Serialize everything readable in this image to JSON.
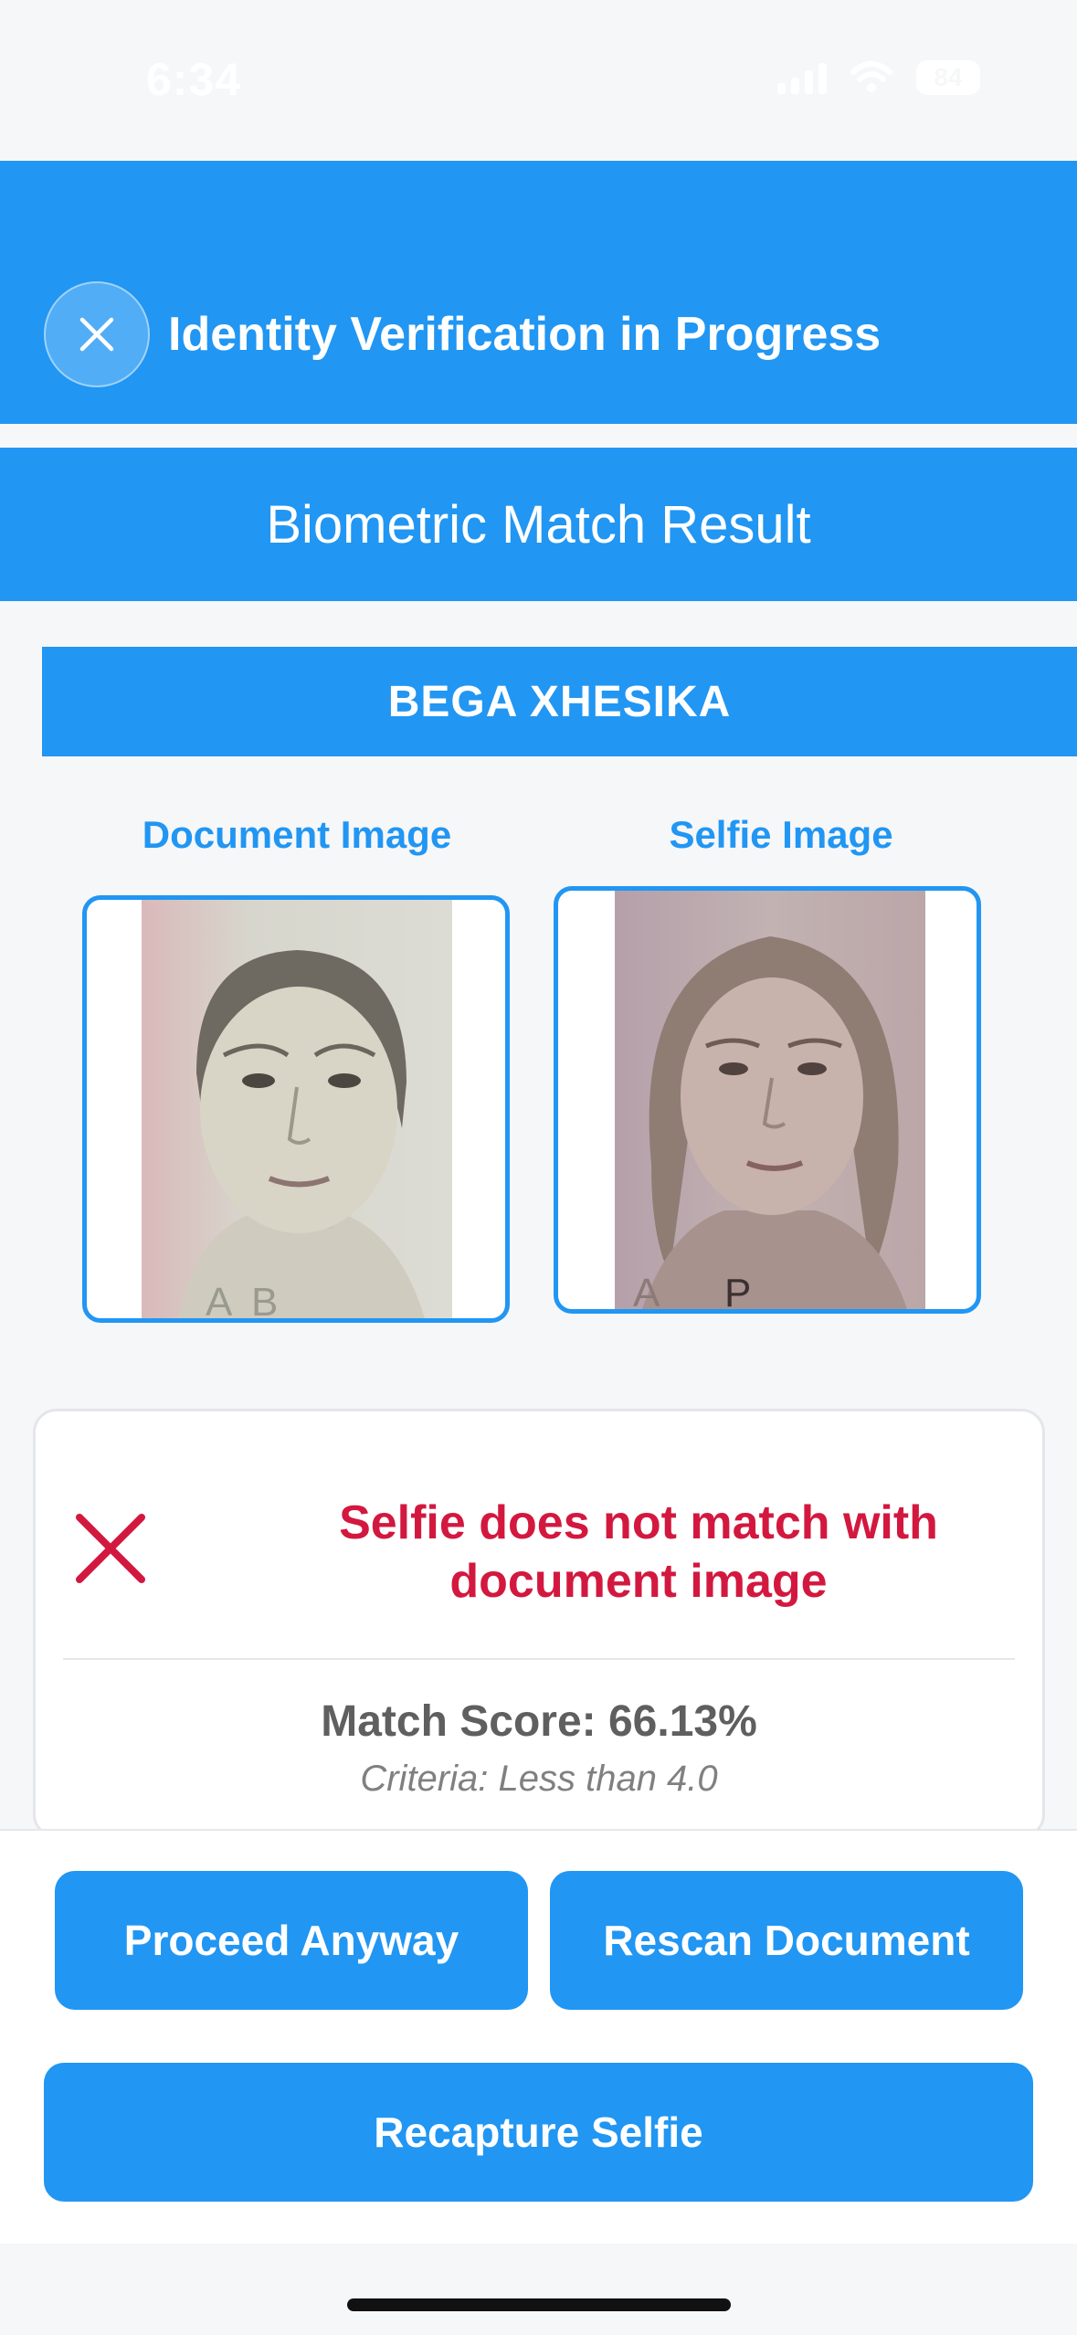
{
  "status_bar": {
    "time": "6:34",
    "battery": "84",
    "icons": [
      "signal-icon",
      "wifi-icon",
      "battery-icon"
    ]
  },
  "header": {
    "close_icon": "close-icon",
    "title": "Identity Verification in Progress"
  },
  "section": {
    "title": "Biometric Match Result"
  },
  "person": {
    "name": "BEGA XHESIKA"
  },
  "images": {
    "document_label": "Document Image",
    "selfie_label": "Selfie Image"
  },
  "result": {
    "status_icon": "x-mark-icon",
    "message": "Selfie does not match with document image",
    "match_score": "Match Score: 66.13%",
    "criteria": "Criteria: Less than 4.0"
  },
  "actions": {
    "proceed": "Proceed Anyway",
    "rescan": "Rescan Document",
    "recapture": "Recapture Selfie"
  },
  "colors": {
    "primary": "#2196f3",
    "error": "#d3183f",
    "background": "#f6f7f9"
  }
}
